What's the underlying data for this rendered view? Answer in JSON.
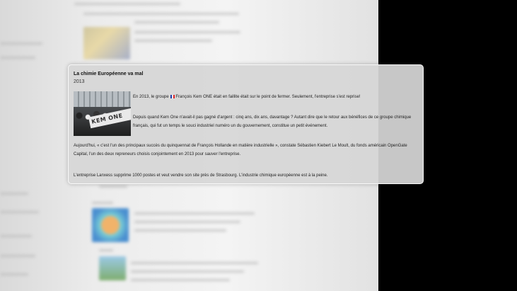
{
  "popup": {
    "title": "La chimie Européenne va mal",
    "year": "2013",
    "photo_banner_text": "KEM ONE",
    "paragraph1_before": "En 2013, le groupe",
    "paragraph1_after": "François Kem ONE était en faillite était sur le point de fermer. Seulement, l'entreprise s'est reprise!",
    "paragraph2": "Depuis quand Kem One n'avait-il pas gagné d'argent : cinq ans, dix ans, davantage ? Autant dire que le retour aux bénéfices de ce groupe chimique français, qui fut un temps le souci industriel numéro un du gouvernement, constitue un petit événement.",
    "paragraph3": "Aujourd'hui, « c'est l'un des principaux succès du quinquennat de François Hollande en matière industrielle », constate Sébastien Kiebert Le Moult, du fonds américain OpenGate Capital, l'un des deux repreneurs choisis conjointement en 2013 pour sauver l'entreprise.",
    "paragraph4": "L'entreprise Lanxess supprime 1000 postes et veut vendre son site près de Strasbourg. L'industrie chimique européenne est à la peine."
  }
}
